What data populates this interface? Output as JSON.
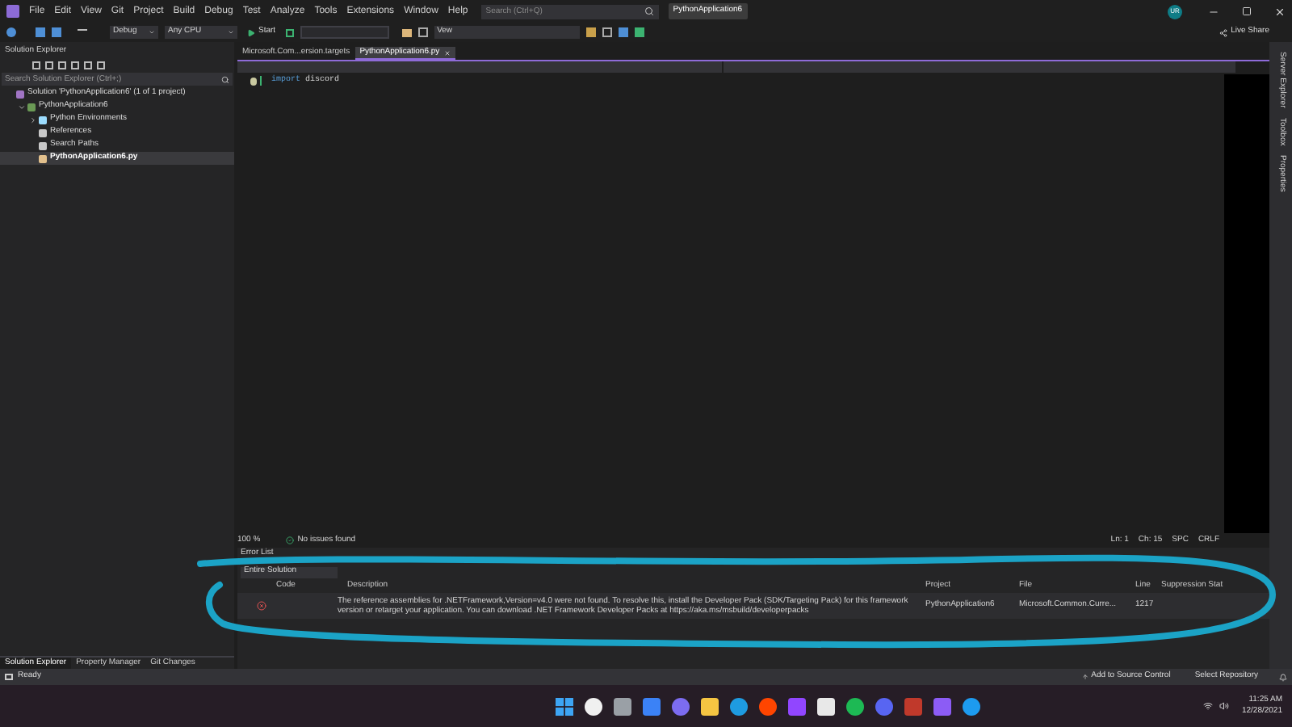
{
  "menu": [
    "File",
    "Edit",
    "View",
    "Git",
    "Project",
    "Build",
    "Debug",
    "Test",
    "Analyze",
    "Tools",
    "Extensions",
    "Window",
    "Help"
  ],
  "search": {
    "placeholder": "Search (Ctrl+Q)"
  },
  "project_title": "PythonApplication6",
  "user_initials": "UR",
  "toolbar": {
    "configuration": "Debug",
    "platform": "Any CPU",
    "start": "Start",
    "find_box": "Vew"
  },
  "live_share": "Live Share",
  "solution_explorer": {
    "title": "Solution Explorer",
    "search_placeholder": "Search Solution Explorer (Ctrl+;)",
    "tree": [
      {
        "kind": "solution",
        "label": "Solution 'PythonApplication6' (1 of 1 project)",
        "selected": false,
        "children": [
          {
            "kind": "project",
            "label": "PythonApplication6",
            "selected": false,
            "expanded": true,
            "children": [
              {
                "kind": "environments",
                "label": "Python Environments",
                "selected": false,
                "expanded": false
              },
              {
                "kind": "references",
                "label": "References",
                "selected": false
              },
              {
                "kind": "paths",
                "label": "Search Paths",
                "selected": false
              },
              {
                "kind": "file",
                "label": "PythonApplication6.py",
                "selected": true
              }
            ]
          }
        ]
      }
    ],
    "bottom_tabs": [
      {
        "label": "Solution Explorer",
        "selected": true
      },
      {
        "label": "Property Manager",
        "selected": false
      },
      {
        "label": "Git Changes",
        "selected": false
      }
    ]
  },
  "editor": {
    "tabs": [
      {
        "label": "Microsoft.Com...ersion.targets",
        "selected": false
      },
      {
        "label": "PythonApplication6.py",
        "selected": true
      }
    ],
    "code": [
      {
        "kind": "keyword",
        "text": "import"
      },
      {
        "kind": "name",
        "text": "discord"
      }
    ],
    "zoom": "100 %",
    "issues": "No issues found",
    "line": "Ln: 1",
    "column": "Ch: 15",
    "whitespace": "SPC",
    "line_ending": "CRLF"
  },
  "right_tabs": [
    "Server Explorer",
    "Toolbox",
    "Properties"
  ],
  "error_list": {
    "title": "Error List",
    "scope": "Entire Solution",
    "columns": [
      "Code",
      "Description",
      "Project",
      "File",
      "Line",
      "Suppression Stat"
    ],
    "rows": [
      {
        "kind": "error",
        "description": "The reference assemblies for .NETFramework,Version=v4.0 were not found. To resolve this, install the Developer Pack (SDK/Targeting Pack) for this framework version or retarget your application. You can download .NET Framework Developer Packs at https://aka.ms/msbuild/developerpacks",
        "project": "PythonApplication6",
        "file": "Microsoft.Common.Curre...",
        "line": "1217"
      }
    ]
  },
  "status_bar": {
    "text": "Ready",
    "source_control": "Add to Source Control",
    "repository": "Select Repository"
  },
  "taskbar": {
    "time": "11:25 AM",
    "date": "12/28/2021"
  }
}
